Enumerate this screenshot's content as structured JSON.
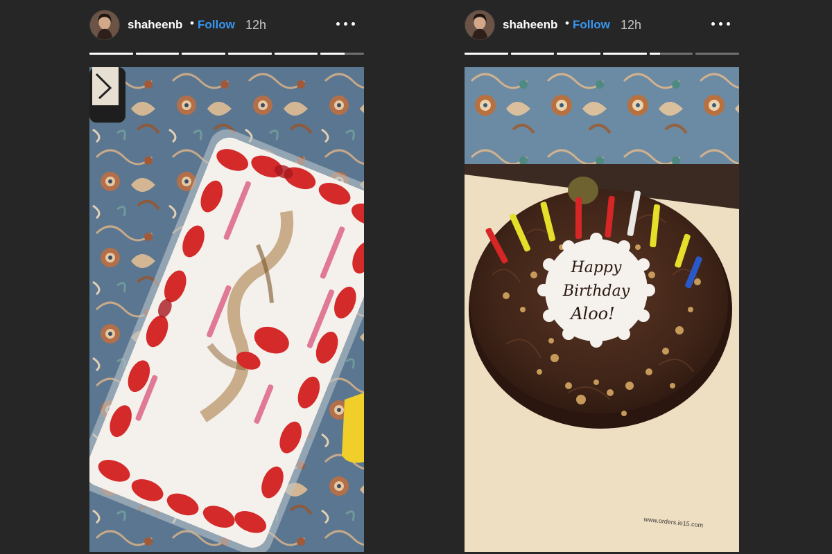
{
  "stories": [
    {
      "username": "shaheenb",
      "dot": "•",
      "follow_label": "Follow",
      "time": "12h",
      "segments_total": 6,
      "segments_completed": 5,
      "current_segment_progress": 0.55,
      "media": {
        "alt": "strawberry cream cake with pink candles"
      }
    },
    {
      "username": "shaheenb",
      "dot": "•",
      "follow_label": "Follow",
      "time": "12h",
      "segments_total": 6,
      "segments_completed": 4,
      "current_segment_progress": 0.25,
      "media": {
        "alt": "chocolate birthday cake with candles",
        "plaque_text_line1": "Happy",
        "plaque_text_line2": "Birthday",
        "plaque_text_line3": "Aloo!",
        "board_text": "www.orders.ie15.com"
      }
    }
  ],
  "colors": {
    "background": "#262626",
    "follow": "#3897f0",
    "username": "#ffffff",
    "time": "#c7c7c7"
  },
  "icons": {
    "more": "more-options-icon"
  }
}
